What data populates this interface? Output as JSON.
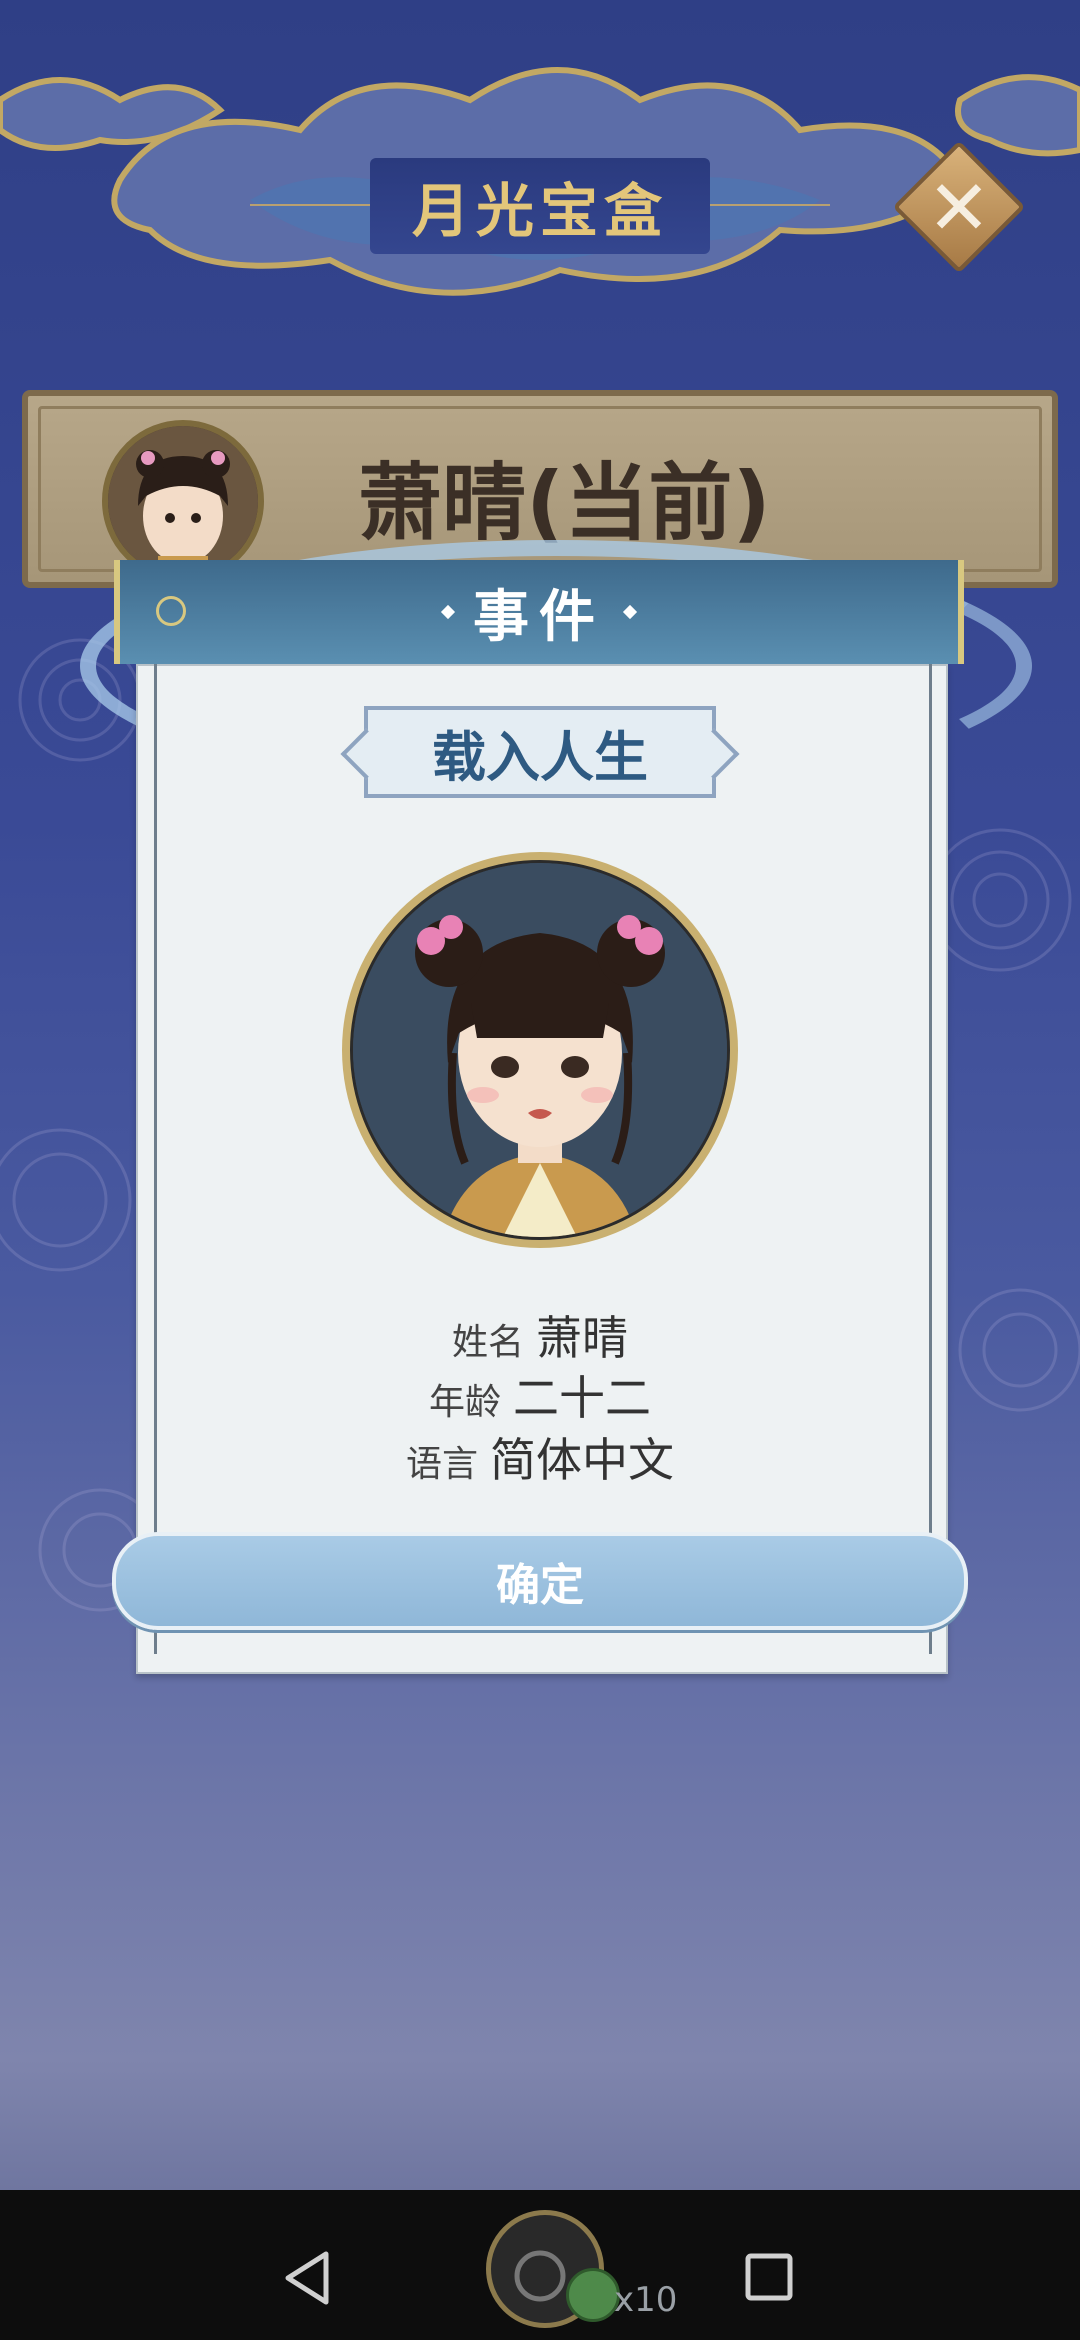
{
  "header": {
    "title": "月光宝盒"
  },
  "profile": {
    "name": "萧晴(当前)"
  },
  "event": {
    "title": "事件",
    "subtitle": "载入人生",
    "fields": [
      {
        "label": "姓名",
        "value": "萧晴"
      },
      {
        "label": "年龄",
        "value": "二十二"
      },
      {
        "label": "语言",
        "value": "简体中文"
      }
    ],
    "confirm_label": "确定"
  },
  "navbar": {
    "multiplier": "x10"
  },
  "colors": {
    "accent": "#e3c67a",
    "dialog_header": "#4a7a9e",
    "confirm": "#9cc1df"
  }
}
